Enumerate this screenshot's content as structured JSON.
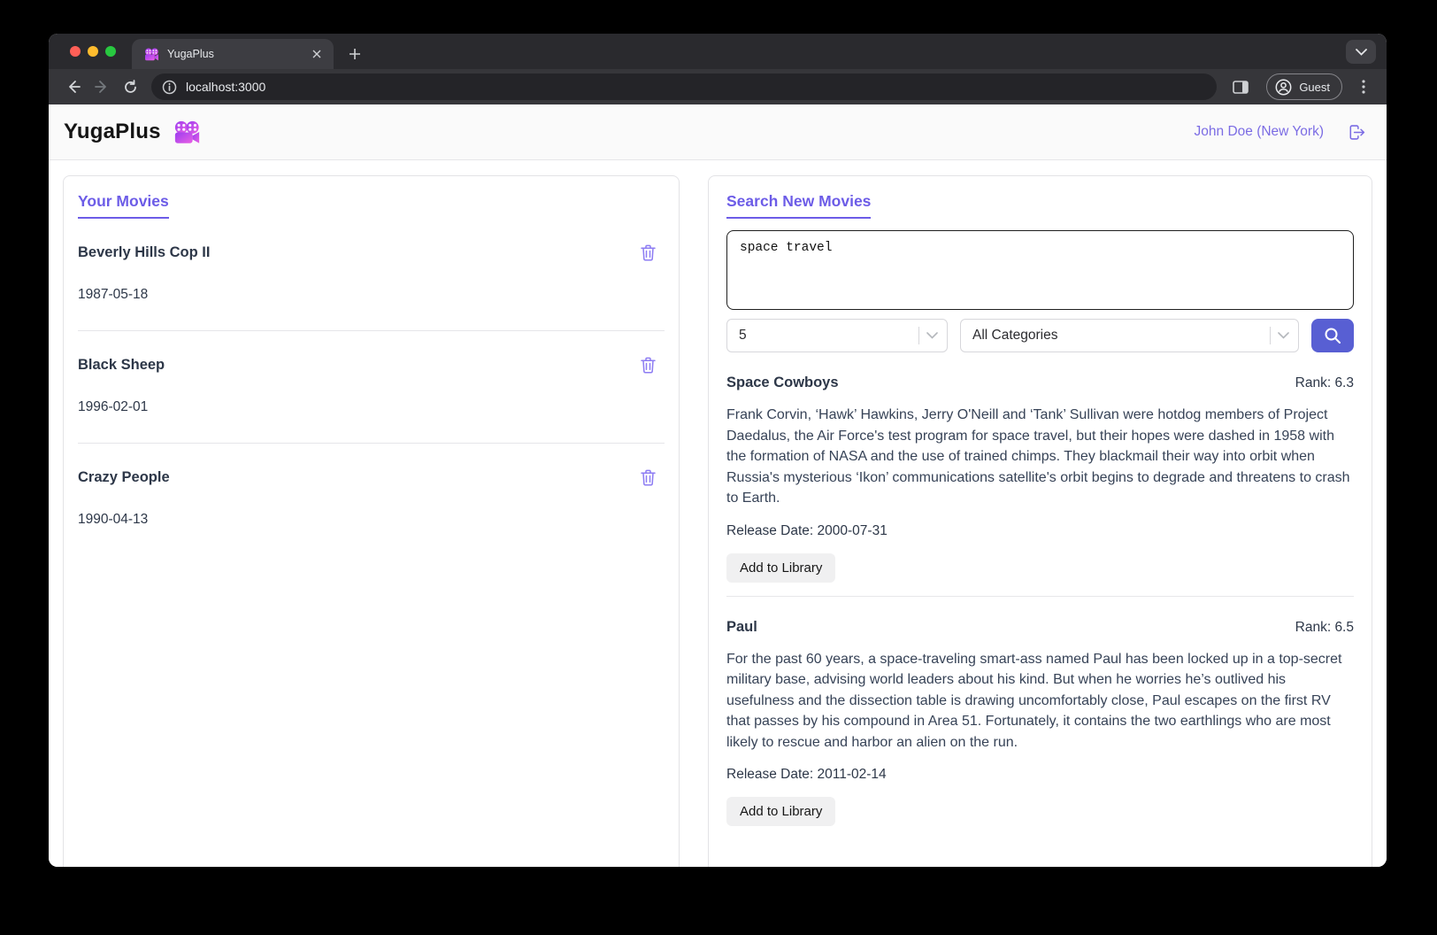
{
  "browser": {
    "tab_title": "YugaPlus",
    "url": "localhost:3000",
    "guest_label": "Guest",
    "icons": {
      "favicon": "movie-camera",
      "back": "arrow-left",
      "forward": "arrow-right",
      "reload": "circular-arrow",
      "site_info": "info-circle",
      "side_panel": "panel-square",
      "profile": "person-circle",
      "menu": "vertical-dots",
      "tab_search": "chevron-down",
      "new_tab": "plus",
      "close_tab": "x"
    }
  },
  "header": {
    "brand": "YugaPlus",
    "brand_icon": "movie-camera",
    "user": "John Doe (New York)",
    "logout_icon": "logout-door-arrow"
  },
  "library": {
    "title": "Your Movies",
    "delete_icon": "trash-can",
    "movies": [
      {
        "title": "Beverly Hills Cop II",
        "date": "1987-05-18"
      },
      {
        "title": "Black Sheep",
        "date": "1996-02-01"
      },
      {
        "title": "Crazy People",
        "date": "1990-04-13"
      }
    ]
  },
  "search": {
    "title": "Search New Movies",
    "query": "space travel",
    "limit_value": "5",
    "category_value": "All Categories",
    "search_icon": "magnifier",
    "results": [
      {
        "title": "Space Cowboys",
        "rank": "Rank: 6.3",
        "description": "Frank Corvin, ‘Hawk’ Hawkins, Jerry O'Neill and ‘Tank’ Sullivan were hotdog members of Project Daedalus, the Air Force's test program for space travel, but their hopes were dashed in 1958 with the formation of NASA and the use of trained chimps. They blackmail their way into orbit when Russia's mysterious ‘Ikon’ communications satellite's orbit begins to degrade and threatens to crash to Earth.",
        "release": "Release Date: 2000-07-31",
        "add_label": "Add to Library"
      },
      {
        "title": "Paul",
        "rank": "Rank: 6.5",
        "description": "For the past 60 years, a space-traveling smart-ass named Paul has been locked up in a top-secret military base, advising world leaders about his kind. But when he worries he’s outlived his usefulness and the dissection table is drawing uncomfortably close, Paul escapes on the first RV that passes by his compound in Area 51. Fortunately, it contains the two earthlings who are most likely to rescue and harbor an alien on the run.",
        "release": "Release Date: 2011-02-14",
        "add_label": "Add to Library"
      }
    ]
  },
  "colors": {
    "accent_purple": "#6c5ce7",
    "user_link_purple": "#7b6ce4",
    "search_button": "#585fd3",
    "trash_icon": "#8d7cf3",
    "traffic_red": "#ff5f57",
    "traffic_yellow": "#febc2e",
    "traffic_green": "#28c840",
    "chrome_dark": "#2a2a2e",
    "toolbar_dark": "#36363a",
    "body_text": "#2d3748"
  }
}
